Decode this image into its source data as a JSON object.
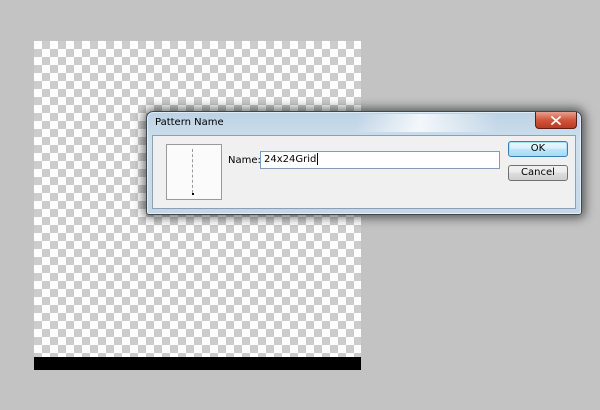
{
  "dialog": {
    "title": "Pattern Name",
    "name_label": "Name:",
    "name_value": "24x24Grid",
    "ok_label": "OK",
    "cancel_label": "Cancel",
    "close_icon": "close-icon"
  },
  "colors": {
    "workspace_bg": "#c3c3c3",
    "close_button": "#c9452b",
    "ok_button_border": "#3c7fb1"
  }
}
